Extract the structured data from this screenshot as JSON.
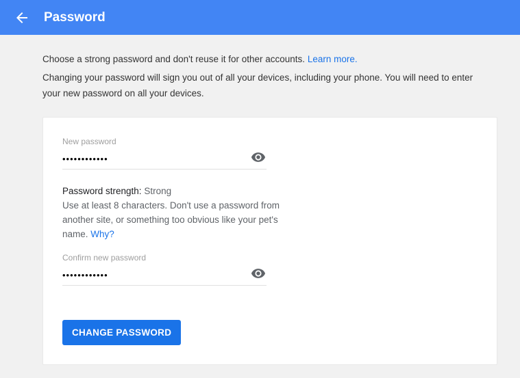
{
  "header": {
    "title": "Password"
  },
  "intro": {
    "line1_a": "Choose a strong password and don't reuse it for other accounts. ",
    "learn_more": "Learn more.",
    "line2": "Changing your password will sign you out of all your devices, including your phone. You will need to enter your new password on all your devices."
  },
  "form": {
    "new_password": {
      "label": "New password",
      "value": "••••••••••••"
    },
    "strength": {
      "label": "Password strength:",
      "value": "Strong",
      "desc_a": "Use at least 8 characters. Don't use a password from another site, or something too obvious like your pet's name. ",
      "why": "Why?"
    },
    "confirm_password": {
      "label": "Confirm new password",
      "value": "••••••••••••"
    },
    "submit_label": "CHANGE PASSWORD"
  }
}
